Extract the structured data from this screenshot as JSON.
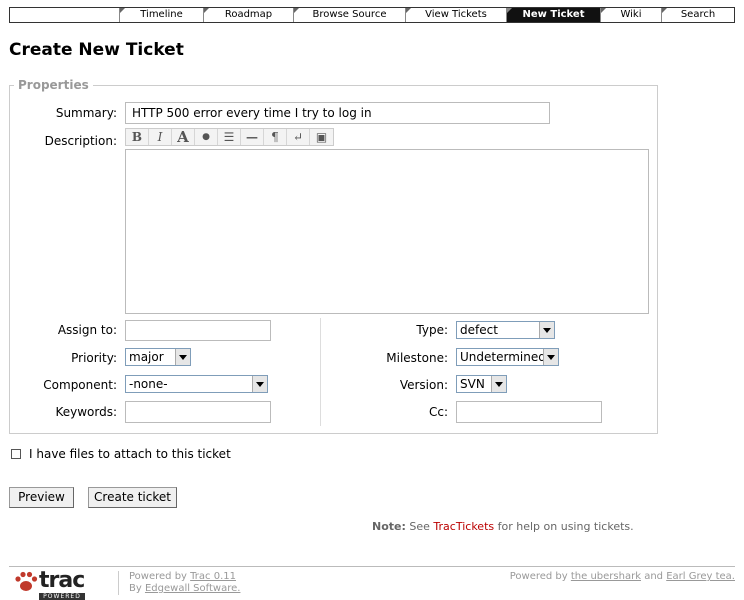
{
  "nav": {
    "items": [
      {
        "label": "Timeline"
      },
      {
        "label": "Roadmap"
      },
      {
        "label": "Browse Source"
      },
      {
        "label": "View Tickets"
      },
      {
        "label": "New Ticket"
      },
      {
        "label": "Wiki"
      },
      {
        "label": "Search"
      }
    ],
    "active": "New Ticket"
  },
  "page_title": "Create New Ticket",
  "properties": {
    "legend": "Properties",
    "summary_label": "Summary:",
    "summary_value": "HTTP 500 error every time I try to log in",
    "description_label": "Description:",
    "description_value": "",
    "assign_label": "Assign to:",
    "assign_value": "",
    "priority_label": "Priority:",
    "priority_value": "major",
    "component_label": "Component:",
    "component_value": "-none-",
    "keywords_label": "Keywords:",
    "keywords_value": "",
    "type_label": "Type:",
    "type_value": "defect",
    "milestone_label": "Milestone:",
    "milestone_value": "Undetermined",
    "version_label": "Version:",
    "version_value": "SVN",
    "cc_label": "Cc:",
    "cc_value": ""
  },
  "toolbar": [
    {
      "glyph": "B",
      "icon": "bold-icon"
    },
    {
      "glyph": "I",
      "icon": "italic-icon"
    },
    {
      "glyph": "A",
      "icon": "heading-icon"
    },
    {
      "glyph": "●",
      "icon": "link-icon"
    },
    {
      "glyph": "☰",
      "icon": "code-block-icon"
    },
    {
      "glyph": "—",
      "icon": "horizontal-rule-icon"
    },
    {
      "glyph": "¶",
      "icon": "paragraph-icon"
    },
    {
      "glyph": "↵",
      "icon": "line-break-icon"
    },
    {
      "glyph": "▣",
      "icon": "image-icon"
    }
  ],
  "attach": {
    "label": "I have files to attach to this ticket",
    "checked": false
  },
  "buttons": {
    "preview": "Preview",
    "create": "Create ticket"
  },
  "note": {
    "prefix": "Note:",
    "see": "See",
    "link": "TracTickets",
    "suffix": "for help on using tickets."
  },
  "footer": {
    "logo_text": "trac",
    "logo_sub": "POWERED",
    "powered_by": "Powered by",
    "trac_version": "Trac 0.11",
    "by": "By",
    "company": "Edgewall Software.",
    "right_prefix": "Powered by",
    "right_link1": "the ubershark",
    "right_and": "and",
    "right_link2": "Earl Grey tea."
  },
  "colors": {
    "nav_active_bg": "#111111",
    "link": "#bb0000",
    "legend": "#999999"
  }
}
